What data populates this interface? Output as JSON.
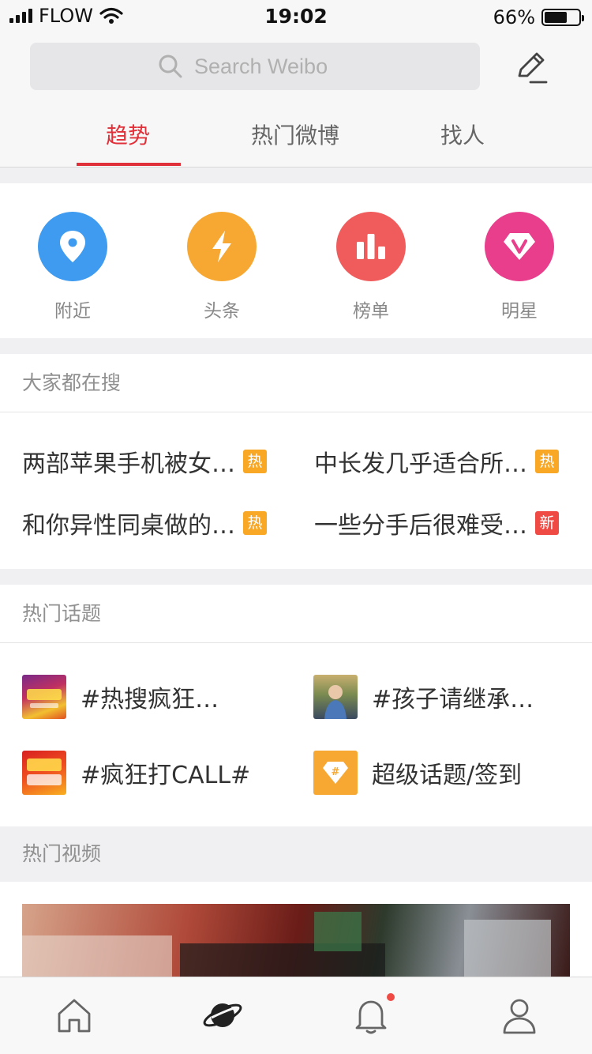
{
  "status_bar": {
    "carrier": "FLOW",
    "time": "19:02",
    "battery": "66%",
    "battery_level": 0.66
  },
  "search": {
    "placeholder": "Search Weibo"
  },
  "tabs": [
    {
      "label": "趋势",
      "active": true
    },
    {
      "label": "热门微博",
      "active": false
    },
    {
      "label": "找人",
      "active": false
    }
  ],
  "quick_entries": [
    {
      "label": "附近",
      "icon": "location-pin-icon",
      "color": "#3e9bf0"
    },
    {
      "label": "头条",
      "icon": "lightning-icon",
      "color": "#f7a832"
    },
    {
      "label": "榜单",
      "icon": "bar-chart-icon",
      "color": "#f05c5c"
    },
    {
      "label": "明星",
      "icon": "diamond-v-icon",
      "color": "#e83e8c"
    }
  ],
  "hot_search": {
    "title": "大家都在搜",
    "items": [
      {
        "text": "两部苹果手机被女…",
        "badge": "热",
        "badge_type": "hot"
      },
      {
        "text": "中长发几乎适合所…",
        "badge": "热",
        "badge_type": "hot"
      },
      {
        "text": "和你异性同桌做的…",
        "badge": "热",
        "badge_type": "hot"
      },
      {
        "text": "一些分手后很难受…",
        "badge": "新",
        "badge_type": "new"
      }
    ]
  },
  "hot_topics": {
    "title": "热门话题",
    "items": [
      {
        "text": "#热搜疯狂…",
        "thumb": "topic-thumb-crazy-search"
      },
      {
        "text": "#孩子请继承…",
        "thumb": "topic-thumb-child-photo"
      },
      {
        "text": "#疯狂打CALL#",
        "thumb": "topic-thumb-crazy-call"
      },
      {
        "text": "超级话题/签到",
        "thumb": "super-topic-icon"
      }
    ]
  },
  "hot_videos": {
    "title": "热门视频"
  },
  "tabbar": [
    {
      "name": "home-icon"
    },
    {
      "name": "discover-planet-icon",
      "active": true
    },
    {
      "name": "notification-bell-icon",
      "has_dot": true
    },
    {
      "name": "profile-icon"
    }
  ],
  "colors": {
    "accent": "#e0313a",
    "hot_badge": "#f9a825",
    "new_badge": "#f04a45"
  }
}
